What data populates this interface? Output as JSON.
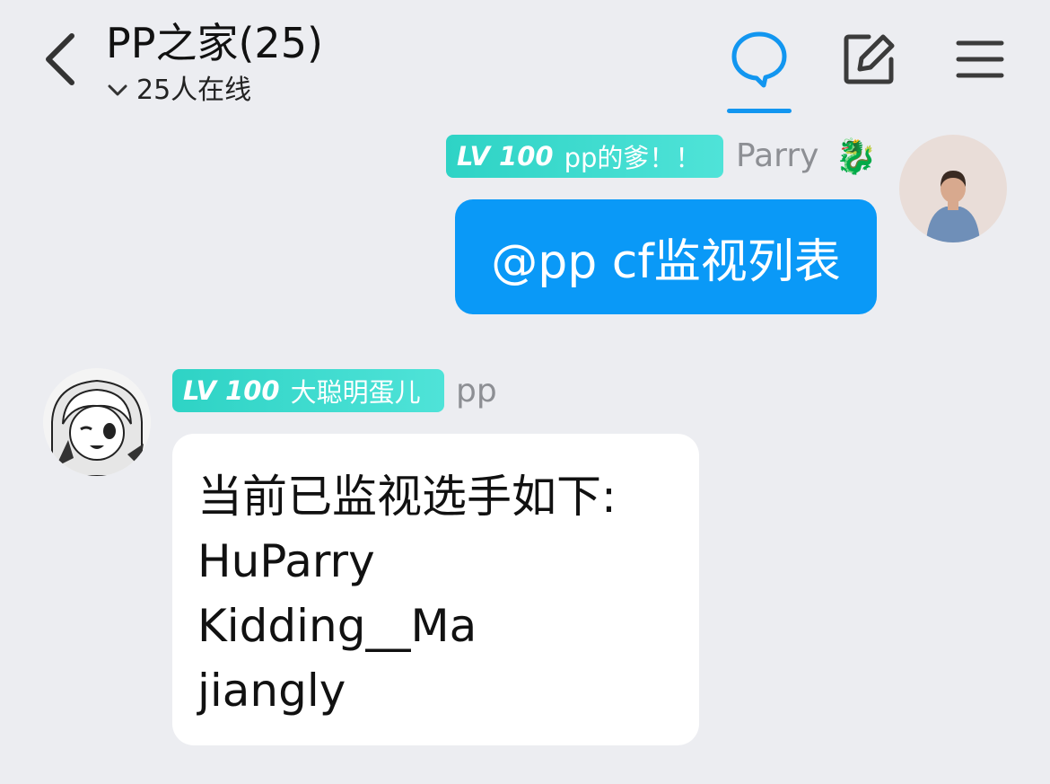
{
  "header": {
    "title": "PP之家(25)",
    "online_text": "25人在线",
    "icons": {
      "back": "back-arrow-icon",
      "chat": "chat-bubble-icon",
      "edit": "edit-square-icon",
      "menu": "hamburger-menu-icon"
    },
    "accent_color": "#1296f0"
  },
  "messages": [
    {
      "side": "right",
      "badge_level": "LV 100",
      "badge_title": "pp的爹！！",
      "sender": "Parry",
      "sender_emoji": "🐉",
      "text": "@pp cf监视列表",
      "bubble_color": "#0a99f7"
    },
    {
      "side": "left",
      "badge_level": "LV 100",
      "badge_title": "大聪明蛋儿",
      "sender": "pp",
      "lines": [
        "当前已监视选手如下:",
        "HuParry",
        "Kidding__Ma",
        "jiangly"
      ],
      "bubble_color": "#ffffff"
    }
  ]
}
